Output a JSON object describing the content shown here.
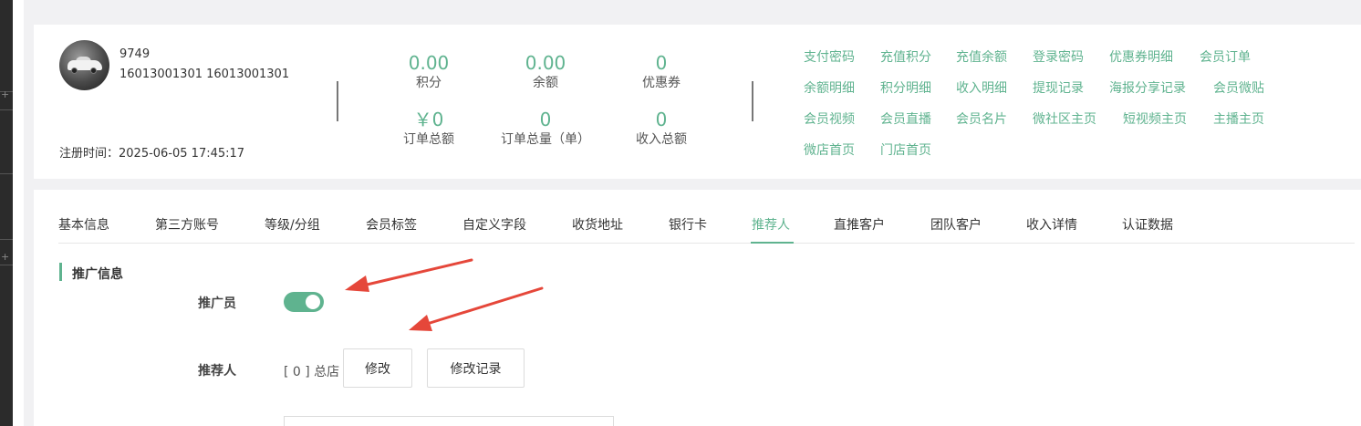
{
  "user": {
    "id": "9749",
    "phone": "16013001301 16013001301",
    "reg_time": "注册时间：2025-06-05 17:45:17"
  },
  "stats": [
    {
      "value": "0.00",
      "label": "积分"
    },
    {
      "value": "0.00",
      "label": "余额"
    },
    {
      "value": "0",
      "label": "优惠券"
    },
    {
      "value": "￥0",
      "label": "订单总额"
    },
    {
      "value": "0",
      "label": "订单总量（单）"
    },
    {
      "value": "0",
      "label": "收入总额"
    }
  ],
  "quick_links": [
    [
      "支付密码",
      "充值积分",
      "充值余额",
      "登录密码",
      "优惠券明细",
      "会员订单"
    ],
    [
      "余额明细",
      "积分明细",
      "收入明细",
      "提现记录",
      "海报分享记录",
      "会员微贴"
    ],
    [
      "会员视频",
      "会员直播",
      "会员名片",
      "微社区主页",
      "短视频主页",
      "主播主页"
    ],
    [
      "微店首页",
      "门店首页"
    ]
  ],
  "tabs": [
    "基本信息",
    "第三方账号",
    "等级/分组",
    "会员标签",
    "自定义字段",
    "收货地址",
    "银行卡",
    "推荐人",
    "直推客户",
    "团队客户",
    "收入详情",
    "认证数据"
  ],
  "active_tab": "推荐人",
  "section": {
    "title": "推广信息",
    "promoter_label": "推广员",
    "promoter_enabled": true,
    "referrer_label": "推荐人",
    "referrer_value": "[ 0 ] 总店",
    "modify_button": "修改",
    "history_button": "修改记录"
  },
  "colors": {
    "accent": "#5fb38f",
    "annotation_arrow": "#e5473a"
  },
  "icons": {
    "avatar": "sports-car-avatar",
    "annotation": "red-arrow-icon"
  }
}
